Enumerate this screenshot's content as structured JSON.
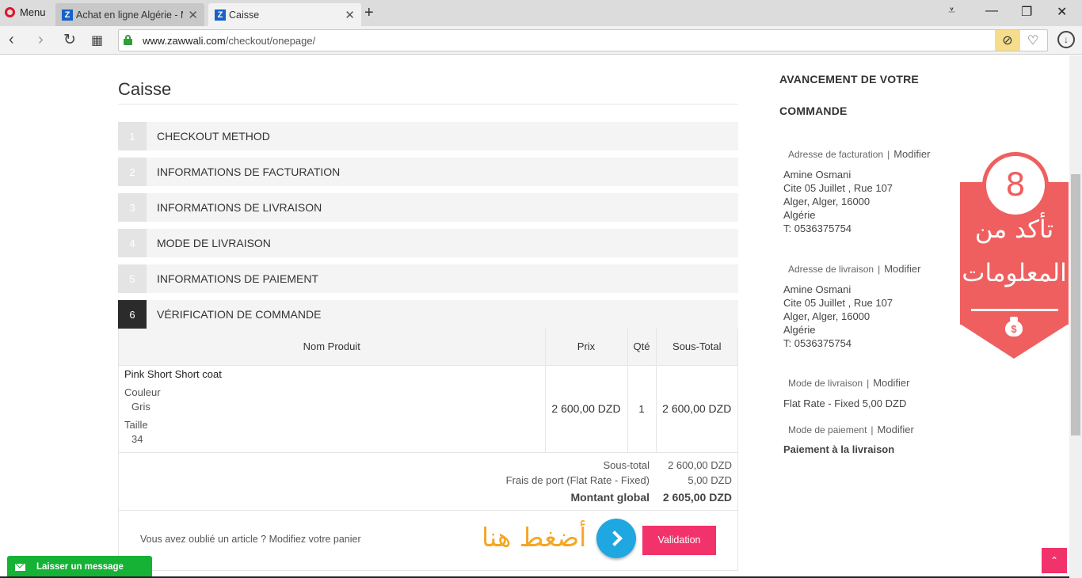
{
  "browser": {
    "menu_label": "Menu",
    "tabs": [
      {
        "title": "Achat en ligne Algérie - M",
        "active": false
      },
      {
        "title": "Caisse",
        "active": true
      }
    ],
    "url_host": "www.zawwali.com",
    "url_path": "/checkout/onepage/"
  },
  "page": {
    "title": "Caisse",
    "steps": [
      {
        "num": "1",
        "label": "CHECKOUT METHOD"
      },
      {
        "num": "2",
        "label": "INFORMATIONS DE FACTURATION"
      },
      {
        "num": "3",
        "label": "INFORMATIONS DE LIVRAISON"
      },
      {
        "num": "4",
        "label": "MODE DE LIVRAISON"
      },
      {
        "num": "5",
        "label": "INFORMATIONS DE PAIEMENT"
      },
      {
        "num": "6",
        "label": "VÉRIFICATION DE COMMANDE"
      }
    ],
    "review": {
      "headers": {
        "name": "Nom Produit",
        "price": "Prix",
        "qty": "Qté",
        "subtotal": "Sous-Total"
      },
      "item": {
        "name": "Pink Short Short coat",
        "options": [
          {
            "label": "Couleur",
            "value": "Gris"
          },
          {
            "label": "Taille",
            "value": "34"
          }
        ],
        "price": "2 600,00 DZD",
        "qty": "1",
        "subtotal": "2 600,00 DZD"
      },
      "totals": [
        {
          "label": "Sous-total",
          "value": "2 600,00 DZD"
        },
        {
          "label": "Frais de port (Flat Rate - Fixed)",
          "value": "5,00 DZD"
        }
      ],
      "grand_total": {
        "label": "Montant global",
        "value": "2 605,00 DZD"
      },
      "forgot_text": "Vous avez oublié un article ?",
      "forgot_link": "Modifiez votre panier",
      "press_here": "أضغط هنا",
      "validate_label": "Validation"
    }
  },
  "sidebar": {
    "title": "AVANCEMENT DE VOTRE COMMANDE",
    "edit_label": "Modifier",
    "billing": {
      "heading": "Adresse de facturation",
      "lines": [
        "Amine Osmani",
        "Cite 05 Juillet , Rue 107",
        "Alger, Alger, 16000",
        "Algérie",
        "T: 0536375754"
      ]
    },
    "shipping": {
      "heading": "Adresse de livraison",
      "lines": [
        "Amine Osmani",
        "Cite 05 Juillet , Rue 107",
        "Alger, Alger, 16000",
        "Algérie",
        "T: 0536375754"
      ]
    },
    "shipping_method": {
      "heading": "Mode de livraison",
      "value": "Flat Rate - Fixed 5,00 DZD"
    },
    "payment_method": {
      "heading": "Mode de paiement",
      "value": "Paiement à la livraison"
    }
  },
  "badge": {
    "number": "8",
    "line1": "تأكد من",
    "line2": "المعلومات",
    "color": "#ef5f5f"
  },
  "widgets": {
    "chat_label": "Laisser un message"
  },
  "colors": {
    "accent_pink": "#f2326a",
    "chat_green": "#15b236",
    "arrow_blue": "#1fa7e1",
    "press_here_orange": "#f5a623"
  }
}
